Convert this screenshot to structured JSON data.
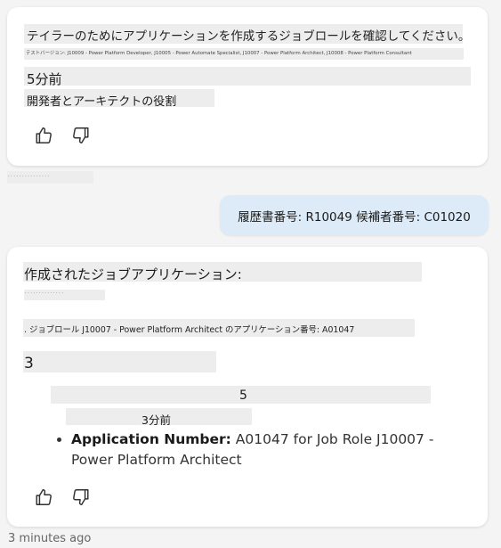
{
  "card1": {
    "headline": "テイラーのためにアプリケーションを作成するジョブロールを確認してください。",
    "subline": "テストバージョン: J10009 - Power Platform Developer, J10005 - Power Automate Specialist, J10007 - Power Platform Architect, J10008 - Power Platform Consultant",
    "time": "5分前",
    "caption": "開発者とアーキテクトの役割"
  },
  "between_note": "· · · · · · · · · · · · · · ·",
  "user_message": "履歴書番号: R10049 候補者番号: C01020",
  "card2": {
    "title": "作成されたジョブアプリケーション:",
    "small_note": "· · · · · · · · · · · · · ·",
    "line": ". ジョブロール J10007 - Power Platform Architect のアプリケーション番号: A01047",
    "number_a": "3",
    "number_b": "5",
    "time": "3分前",
    "bullet": {
      "label": "Application Number:",
      "text": " A01047 for Job Role J10007 - Power Platform Architect"
    }
  },
  "footer_time": "3 minutes ago",
  "icons": {
    "like": "thumbs-up-icon",
    "dislike": "thumbs-down-icon"
  }
}
